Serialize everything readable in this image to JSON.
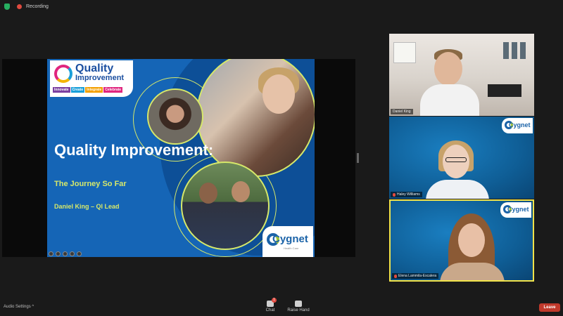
{
  "topbar": {
    "recording_label": "Recording"
  },
  "slide": {
    "logo": {
      "line1": "Quality",
      "line2": "Improvement",
      "tags": [
        "Innovate",
        "Create",
        "Integrate",
        "Celebrate"
      ]
    },
    "title": "Quality Improvement:",
    "subtitle": "The Journey So Far",
    "author": "Daniel King – QI Lead",
    "brand": "Cygnet",
    "brand_sub": "Health Care"
  },
  "participants": [
    {
      "name": "Daniel King",
      "muted": false,
      "active_speaker": false
    },
    {
      "name": "Haley Williams",
      "muted": true,
      "active_speaker": false,
      "badge": "Cygnet"
    },
    {
      "name": "Elena Lammila-Escalera",
      "muted": true,
      "active_speaker": true,
      "badge": "Cygnet"
    }
  ],
  "bottombar": {
    "audio_settings": "Audio Settings",
    "chat_label": "Chat",
    "chat_count": "1",
    "raise_hand_label": "Raise Hand",
    "leave_label": "Leave"
  },
  "colors": {
    "accent": "#d6e86a",
    "slide_bg": "#1565b6",
    "leave": "#c0392b",
    "active_border": "#f1e34a"
  }
}
